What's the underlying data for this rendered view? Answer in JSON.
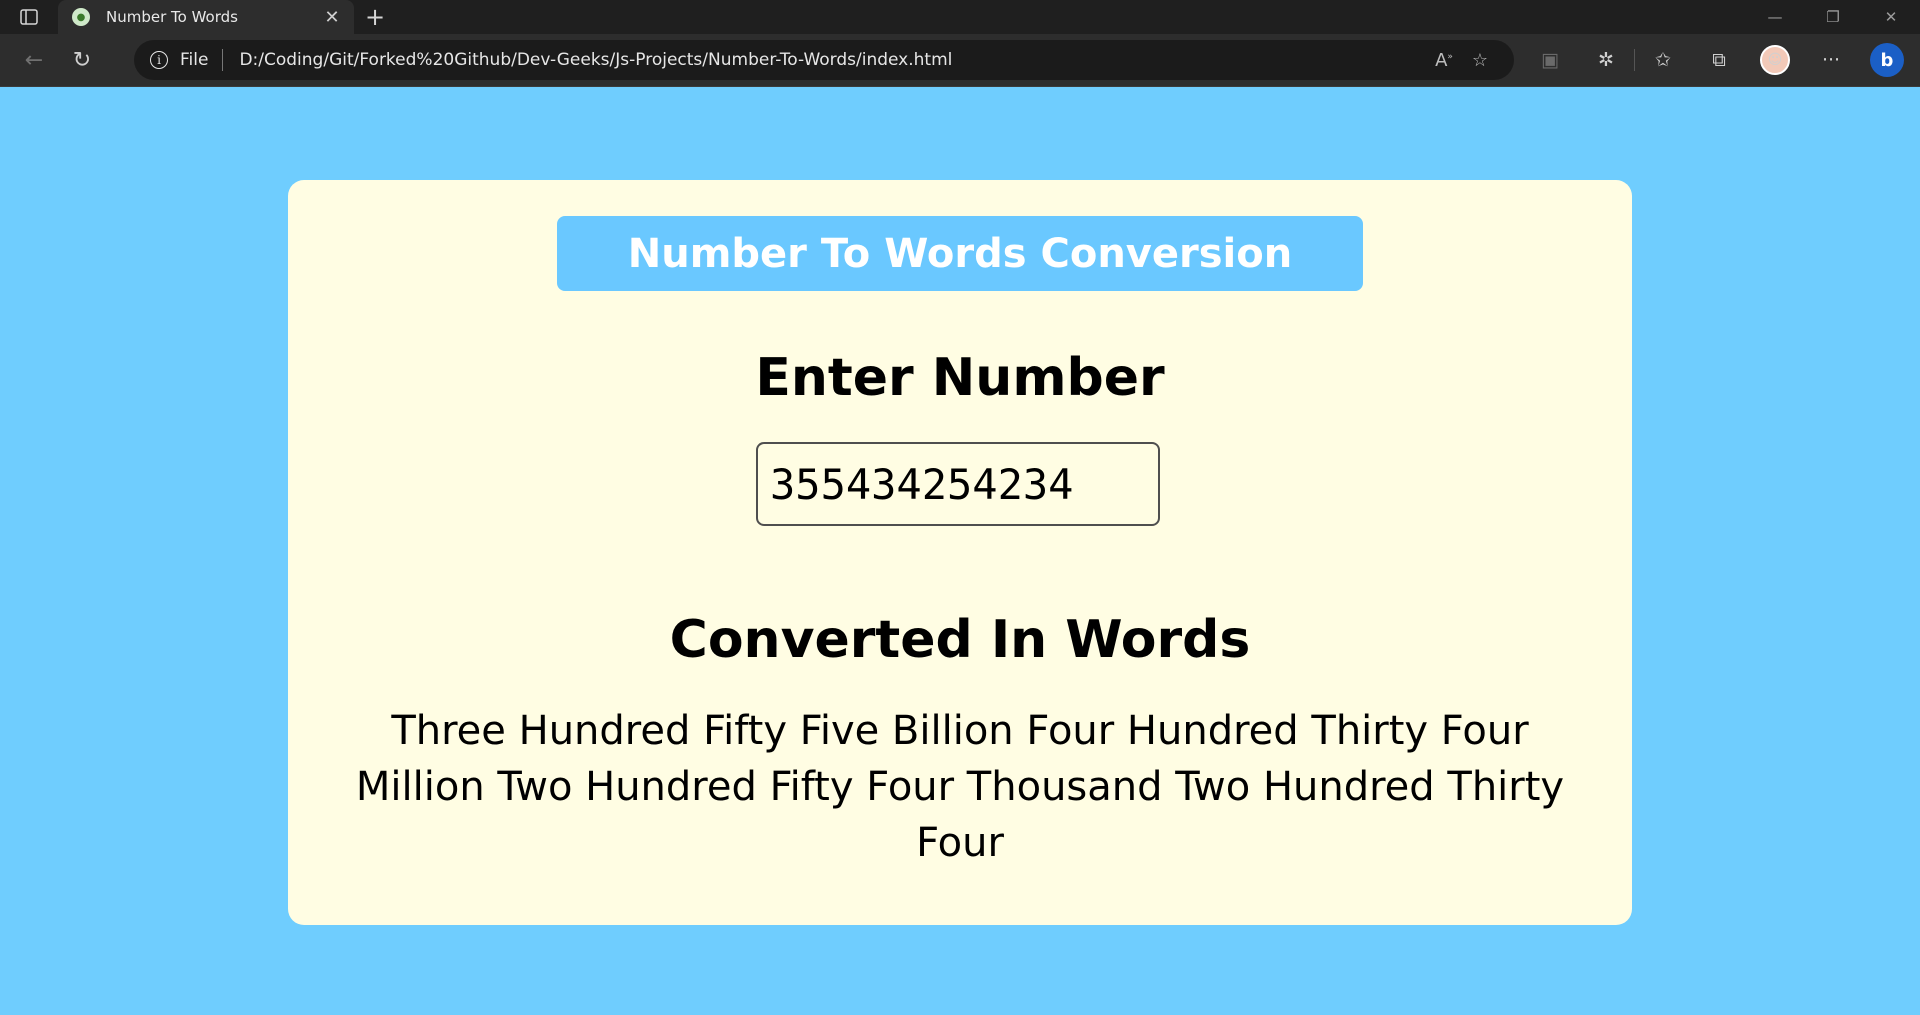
{
  "browser": {
    "tab_title": "Number To Words",
    "address_scheme": "File",
    "address_url": "D:/Coding/Git/Forked%20Github/Dev-Geeks/Js-Projects/Number-To-Words/index.html",
    "icons": [
      "tab-actions-icon",
      "close-icon",
      "plus-icon",
      "minimize-icon",
      "restore-icon",
      "back-icon",
      "refresh-icon",
      "info-icon",
      "read-aloud-icon",
      "add-favorite-icon",
      "extension-icon",
      "puzzle-icon",
      "favorites-icon",
      "collections-icon",
      "avatar",
      "more-icon",
      "bing-icon"
    ]
  },
  "page": {
    "heading": "Number To Words Conversion",
    "input_label": "Enter Number",
    "input_value": "355434254234",
    "output_label": "Converted In Words",
    "output_text": "Three Hundred Fifty Five Billion Four Hundred Thirty Four Million Two Hundred Fifty Four Thousand Two Hundred Thirty Four"
  },
  "colors": {
    "page_bg": "#6fcdfe",
    "card_bg": "#fffde3",
    "banner_bg": "#6ac8ff",
    "banner_text": "#ffffff"
  }
}
